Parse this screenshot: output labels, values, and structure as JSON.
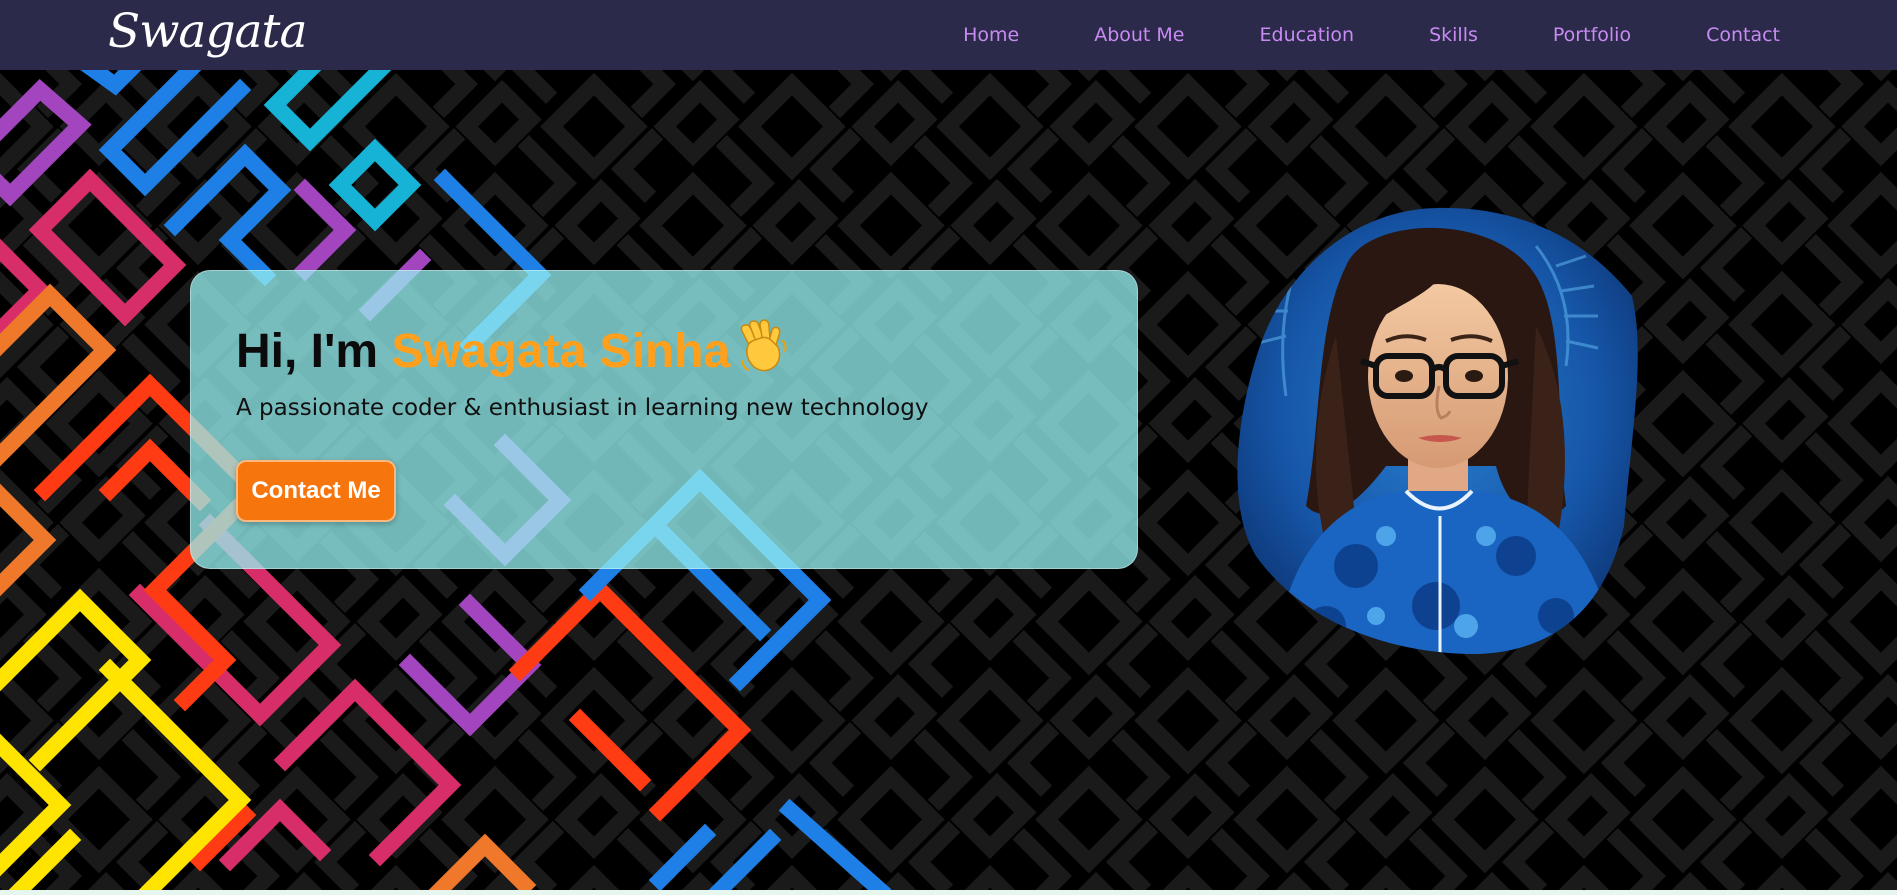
{
  "nav": {
    "logo_text": "Swagata",
    "links": [
      {
        "label": "Home"
      },
      {
        "label": "About Me"
      },
      {
        "label": "Education"
      },
      {
        "label": "Skills"
      },
      {
        "label": "Portfolio"
      },
      {
        "label": "Contact"
      }
    ]
  },
  "hero": {
    "greeting_prefix": "Hi, I'm",
    "name": "Swagata Sinha",
    "wave_icon": "waving-hand-icon",
    "subtitle": "A passionate coder & enthusiast in learning new technology",
    "contact_button_label": "Contact Me"
  },
  "colors": {
    "nav_bg": "#2c2a4a",
    "nav_link": "#c78bf2",
    "accent_name": "#ff9f1c",
    "button_bg": "#f7750d",
    "card_bg": "#96f0f0"
  }
}
